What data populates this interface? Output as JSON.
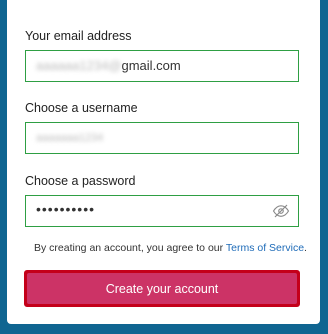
{
  "form": {
    "email_label": "Your email address",
    "email_value_domain": "gmail.com",
    "username_label": "Choose a username",
    "password_label": "Choose a password",
    "password_mask": "••••••••••",
    "terms_text": "By creating an account, you agree to our ",
    "terms_link": "Terms of Service",
    "terms_suffix": ".",
    "submit_label": "Create your account"
  },
  "colors": {
    "background": "#0f6591",
    "field_border": "#2e9f43",
    "cta": "#cc3366",
    "cta_border": "#c4001a",
    "link": "#1e6bb8"
  }
}
